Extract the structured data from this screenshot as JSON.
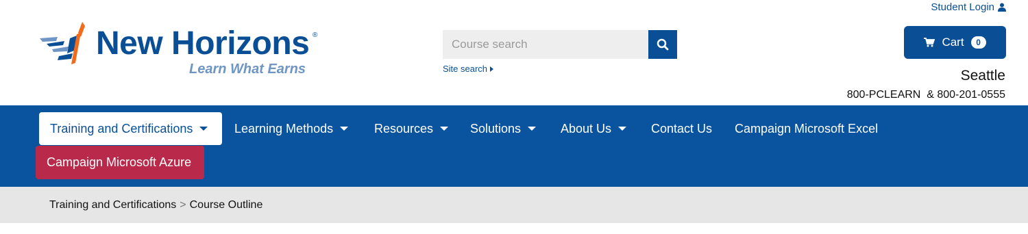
{
  "header": {
    "student_login": "Student Login",
    "logo": {
      "name": "New Horizons",
      "reg": "®",
      "tagline": "Learn What Earns"
    },
    "search": {
      "placeholder": "Course search",
      "site_search": "Site search"
    },
    "cart": {
      "label": "Cart",
      "count": "0"
    },
    "location": {
      "city": "Seattle",
      "phones": "800-PCLEARN  & 800-201-0555"
    }
  },
  "nav": {
    "items": [
      {
        "label": "Training and Certifications",
        "dropdown": true,
        "active": true
      },
      {
        "label": "Learning Methods",
        "dropdown": true
      },
      {
        "label": "Resources",
        "dropdown": true
      },
      {
        "label": "Solutions",
        "dropdown": true
      },
      {
        "label": "About Us",
        "dropdown": true
      },
      {
        "label": "Contact Us",
        "dropdown": false
      },
      {
        "label": "Campaign Microsoft Excel",
        "dropdown": false
      }
    ],
    "campaign_azure": "Campaign Microsoft Azure"
  },
  "breadcrumb": {
    "items": [
      "Training and Certifications",
      "Course Outline"
    ],
    "separator": ">"
  },
  "colors": {
    "brand_blue": "#0a4f95",
    "nav_blue": "#0a539e",
    "campaign_red": "#b9294a",
    "logo_orange": "#f26a1b",
    "tagline_blue": "#6e95c4"
  },
  "icons": [
    "user-icon",
    "search-icon",
    "caret-right-icon",
    "cart-icon",
    "chevron-down-icon"
  ]
}
